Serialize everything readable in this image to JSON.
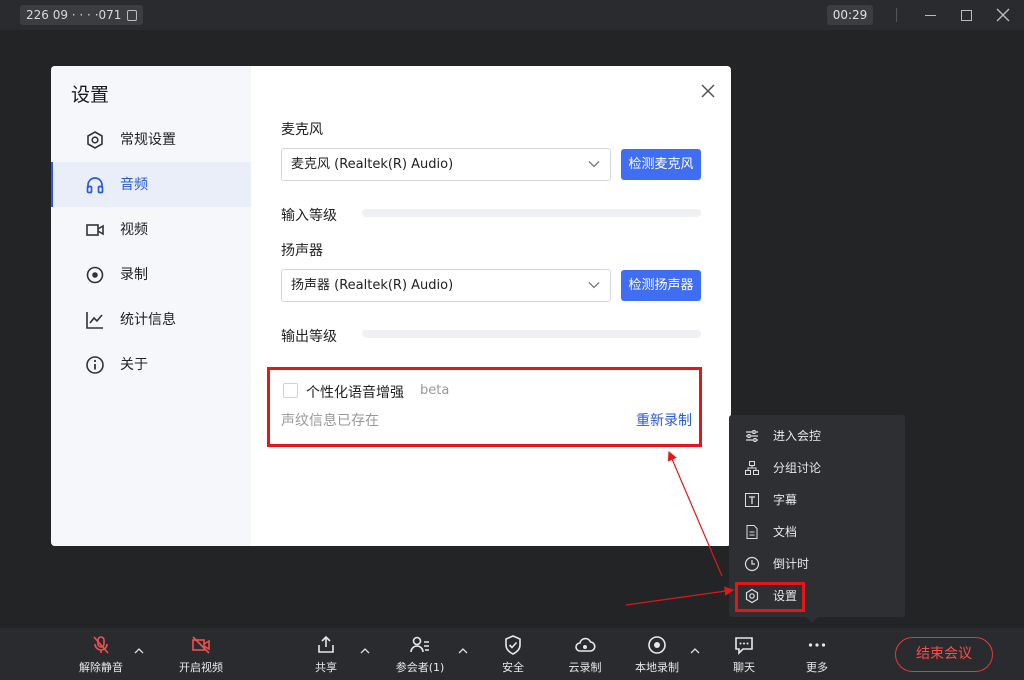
{
  "titlebar": {
    "meeting_id": "226 09 · · · ·071",
    "timer": "00:29"
  },
  "dialog": {
    "title": "设置",
    "sidebar": [
      {
        "label": "常规设置",
        "icon": "gear-hex-icon"
      },
      {
        "label": "音频",
        "icon": "headphones-icon",
        "active": true
      },
      {
        "label": "视频",
        "icon": "video-camera-icon"
      },
      {
        "label": "录制",
        "icon": "record-icon"
      },
      {
        "label": "统计信息",
        "icon": "line-chart-icon"
      },
      {
        "label": "关于",
        "icon": "info-icon"
      }
    ],
    "audio": {
      "mic_label": "麦克风",
      "mic_device": "麦克风 (Realtek(R) Audio)",
      "mic_test_button": "检测麦克风",
      "input_level_label": "输入等级",
      "input_level": 0,
      "speaker_label": "扬声器",
      "speaker_device": "扬声器 (Realtek(R) Audio)",
      "speaker_test_button": "检测扬声器",
      "output_level_label": "输出等级",
      "output_level": 0,
      "enhancement_label": "个性化语音增强",
      "enhancement_checked": false,
      "beta_tag": "beta",
      "voiceprint_status": "声纹信息已存在",
      "rerecord_link": "重新录制"
    }
  },
  "more_menu": {
    "items": [
      {
        "label": "进入会控",
        "icon": "sliders-icon"
      },
      {
        "label": "分组讨论",
        "icon": "breakout-rooms-icon"
      },
      {
        "label": "字幕",
        "icon": "caption-icon"
      },
      {
        "label": "文档",
        "icon": "document-icon"
      },
      {
        "label": "倒计时",
        "icon": "clock-icon"
      },
      {
        "label": "设置",
        "icon": "settings-icon"
      }
    ]
  },
  "toolbar": {
    "unmute": "解除静音",
    "start_video": "开启视频",
    "share": "共享",
    "participants": "参会者(1)",
    "security": "安全",
    "cloud_record": "云录制",
    "local_record": "本地录制",
    "chat": "聊天",
    "more": "更多",
    "end_meeting": "结束会议"
  },
  "colors": {
    "accent": "#3f6ef2",
    "highlight_box": "#e01818",
    "danger": "#ff4a4a"
  }
}
